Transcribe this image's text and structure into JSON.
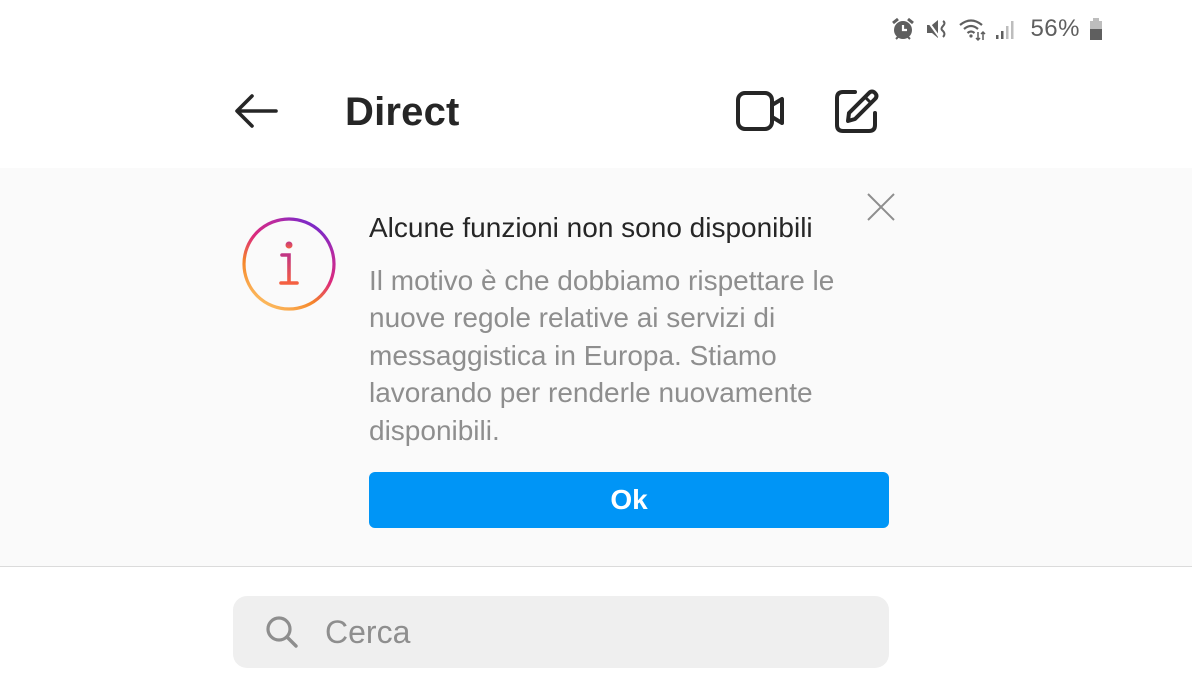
{
  "status_bar": {
    "icons": [
      "alarm-icon",
      "mute-icon",
      "wifi-icon",
      "signal-icon",
      "battery-icon"
    ],
    "battery_percent": "56%"
  },
  "header": {
    "back_icon": "arrow-left-icon",
    "title": "Direct",
    "video_icon": "video-camera-icon",
    "compose_icon": "new-message-icon"
  },
  "banner": {
    "icon": "info-icon",
    "title": "Alcune funzioni non sono disponibili",
    "body": "Il motivo è che dobbiamo rispettare le nuove regole relative ai servizi di messaggistica in Europa. Stiamo lavorando per renderle nuovamente disponibili.",
    "ok_label": "Ok",
    "close_icon": "close-icon",
    "accent_color": "#0095f6"
  },
  "search": {
    "placeholder": "Cerca",
    "value": ""
  }
}
